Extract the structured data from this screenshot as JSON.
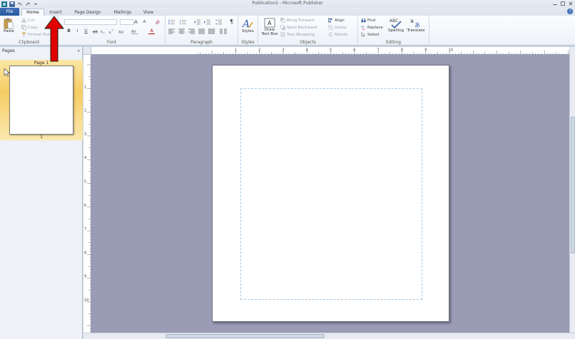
{
  "window": {
    "title": "Publication2 - Microsoft Publisher"
  },
  "tabs": {
    "file": "File",
    "home": "Home",
    "insert": "Insert",
    "page_design": "Page Design",
    "mailings": "Mailings",
    "view": "View"
  },
  "ribbon": {
    "clipboard": {
      "label": "Clipboard",
      "paste": "Paste",
      "cut": "Cut",
      "copy": "Copy",
      "format_painter": "Format Painter"
    },
    "font": {
      "label": "Font",
      "bold": "B",
      "italic": "I",
      "underline": "U",
      "grow": "A",
      "shrink": "A",
      "font_color": "A"
    },
    "paragraph": {
      "label": "Paragraph",
      "pilcrow": "¶"
    },
    "styles": {
      "label": "Styles",
      "styles_btn": "Styles"
    },
    "objects": {
      "label": "Objects",
      "draw_text_box": "Draw Text Box",
      "bring_forward": "Bring Forward",
      "send_backward": "Send Backward",
      "text_wrapping": "Text Wrapping",
      "align": "Align",
      "group": "Group",
      "rotate": "Rotate"
    },
    "editing": {
      "label": "Editing",
      "find": "Find",
      "replace": "Replace",
      "select": "Select",
      "spelling": "Spelling",
      "translate": "Translate"
    }
  },
  "pages_pane": {
    "title": "Pages",
    "collapse": "«",
    "page_label": "Page 1",
    "page_number": "1"
  },
  "rulers": {
    "horizontal": [
      "1",
      "2",
      "3",
      "4",
      "5",
      "6",
      "7",
      "8",
      "9",
      "10"
    ],
    "vertical": [
      "1",
      "2",
      "3",
      "4",
      "5",
      "6",
      "7",
      "8",
      "9",
      "10"
    ]
  },
  "colors": {
    "canvas": "#9a9bb5",
    "file_tab": "#2b5ea6",
    "selected_thumb": "#f6cd63",
    "arrow": "#e00000"
  }
}
